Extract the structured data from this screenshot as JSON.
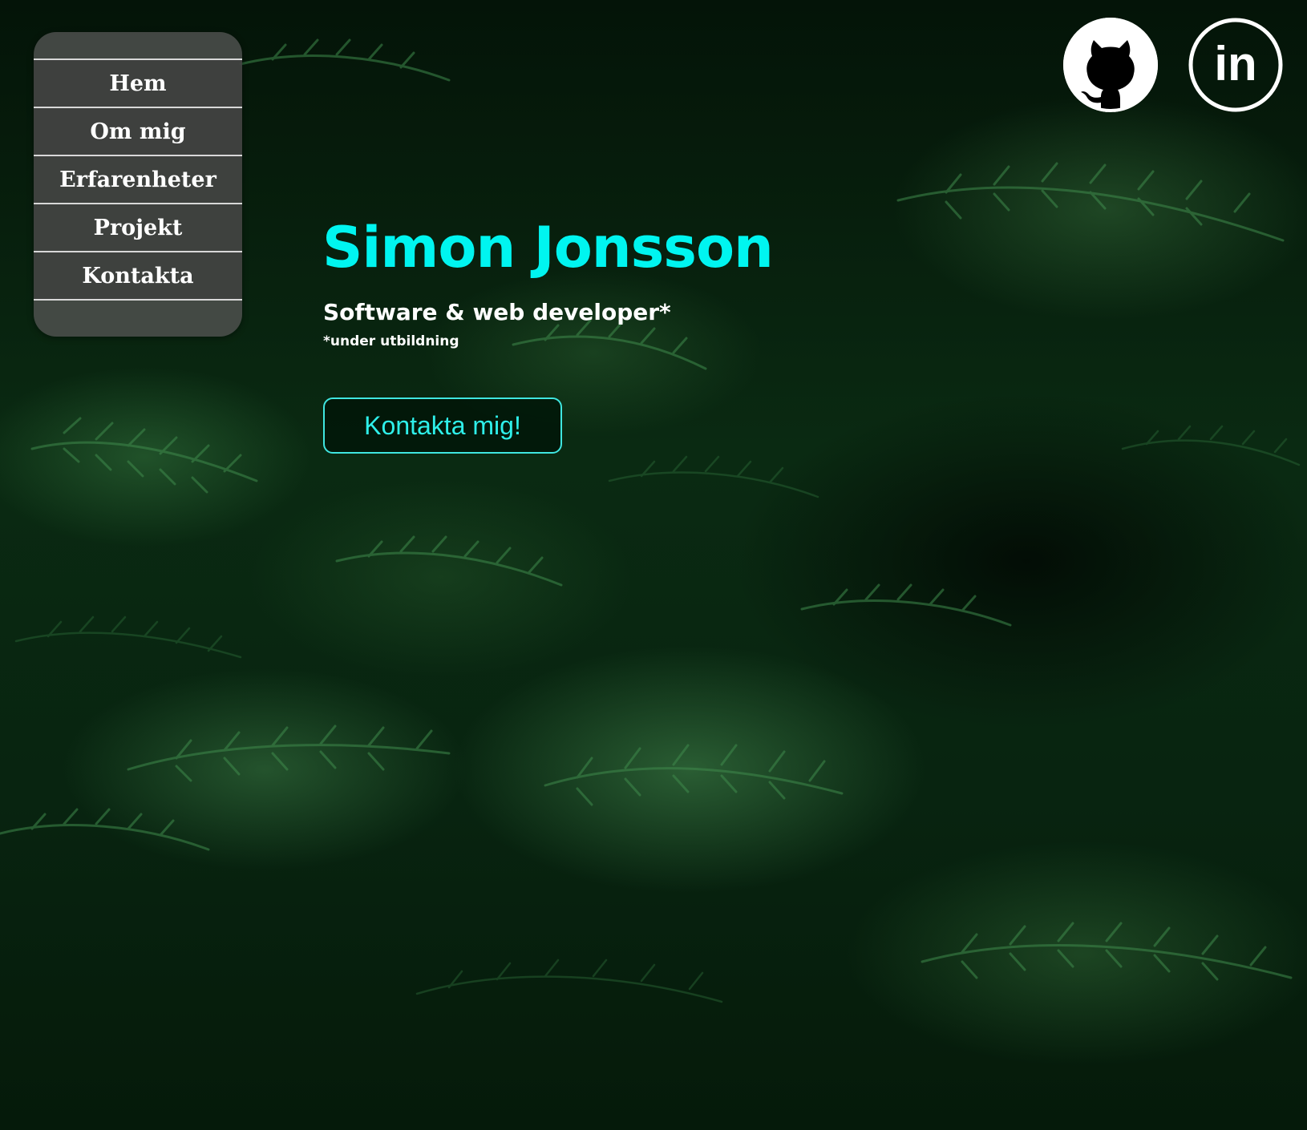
{
  "nav": {
    "items": [
      {
        "label": "Hem"
      },
      {
        "label": "Om mig"
      },
      {
        "label": "Erfarenheter"
      },
      {
        "label": "Projekt"
      },
      {
        "label": "Kontakta"
      }
    ]
  },
  "social": {
    "github_icon": "github-icon",
    "linkedin_icon": "linkedin-icon",
    "linkedin_text": "in"
  },
  "hero": {
    "name": "Simon Jonsson",
    "role": "Software & web developer*",
    "note": "*under utbildning",
    "cta_label": "Kontakta mig!"
  },
  "colors": {
    "accent": "#00f5f0",
    "nav_bg": "#505250",
    "text": "#ffffff",
    "background": "#0a2a12"
  }
}
